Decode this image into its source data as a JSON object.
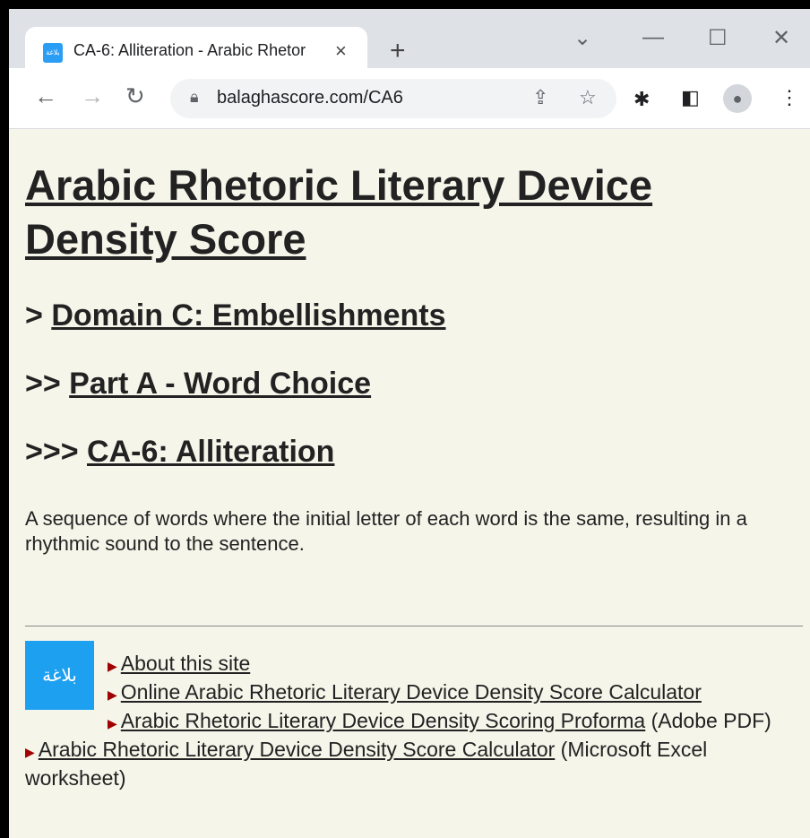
{
  "browser": {
    "tab_title": "CA-6: Alliteration - Arabic Rhetor",
    "tab_close": "×",
    "new_tab": "+",
    "url": "balaghascore.com/CA6",
    "favicon_text": "بلاغة",
    "icons": [
      "back-icon",
      "forward-icon",
      "reload-icon",
      "lock-icon",
      "share-icon",
      "star-icon",
      "extensions-icon",
      "side-panel-icon",
      "profile-icon",
      "menu-icon",
      "minimize-icon",
      "maximize-icon",
      "close-icon",
      "tab-search-icon"
    ]
  },
  "page": {
    "title": "Arabic Rhetoric Literary Device Density Score",
    "h2a_prefix": "> ",
    "h2a_link": "Domain C: Embellishments",
    "h2b_prefix": ">> ",
    "h2b_link": "Part A - Word Choice",
    "h2c_prefix": ">>> ",
    "h2c_link": "CA-6: Alliteration",
    "description": "A sequence of words where the initial letter of each word is the same, resulting in a rhythmic sound to the sentence.",
    "logo_text": "بلاغة",
    "links": {
      "about": "About this site",
      "calculator": "Online Arabic Rhetoric Literary Device Density Score Calculator",
      "proforma": "Arabic Rhetoric Literary Device Density Scoring Proforma",
      "proforma_suffix": " (Adobe PDF)",
      "excel": "Arabic Rhetoric Literary Device Density Score Calculator",
      "excel_suffix": " (Microsoft Excel worksheet)"
    }
  },
  "colors": {
    "background": "#f5f5ea",
    "logo": "#1ea0f0",
    "arrow": "#a00000"
  }
}
